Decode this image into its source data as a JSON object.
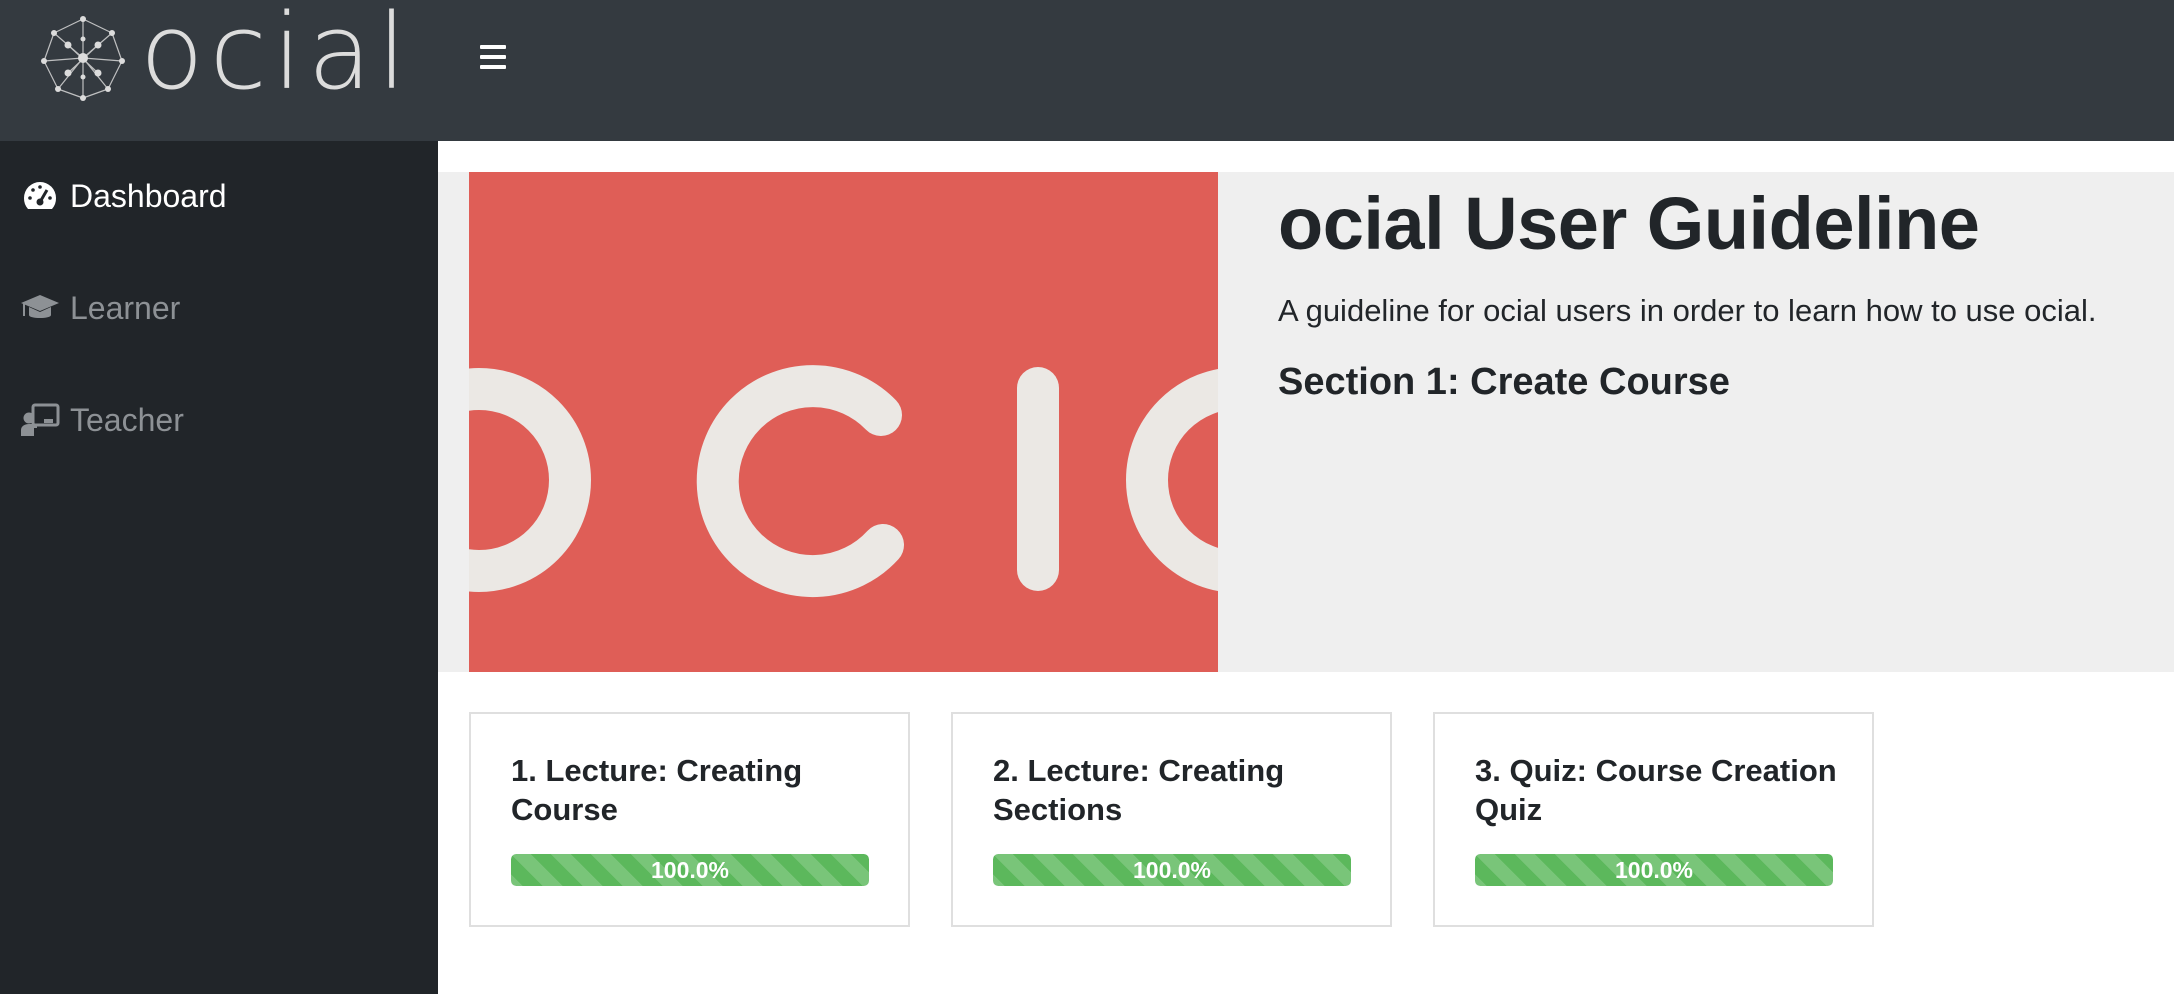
{
  "brand": {
    "name": "ocial",
    "logo_icon": "network-node-icon"
  },
  "topbar": {
    "menu_icon": "hamburger-icon"
  },
  "sidebar": {
    "items": [
      {
        "label": "Dashboard",
        "icon": "tachometer-icon",
        "active": true
      },
      {
        "label": "Learner",
        "icon": "graduation-cap-icon",
        "active": false
      },
      {
        "label": "Teacher",
        "icon": "chalkboard-teacher-icon",
        "active": false
      }
    ]
  },
  "jumbotron": {
    "image_text": "ocial",
    "title": "ocial User Guideline",
    "description": "A guideline for ocial users in order to learn how to use ocial.",
    "section": "Section 1: Create Course"
  },
  "cards": [
    {
      "title": "1. Lecture: Creating Course",
      "progress": 1.0,
      "progress_label": "100.0%"
    },
    {
      "title": "2. Lecture: Creating Sections",
      "progress": 1.0,
      "progress_label": "100.0%"
    },
    {
      "title": "3. Quiz: Course Creation Quiz",
      "progress": 1.0,
      "progress_label": "100.0%"
    }
  ],
  "colors": {
    "navbar": "#343a40",
    "sidebar": "#212529",
    "hero_image": "#df5e57",
    "progress": "#5cb85c",
    "jumbotron": "#efefef"
  }
}
